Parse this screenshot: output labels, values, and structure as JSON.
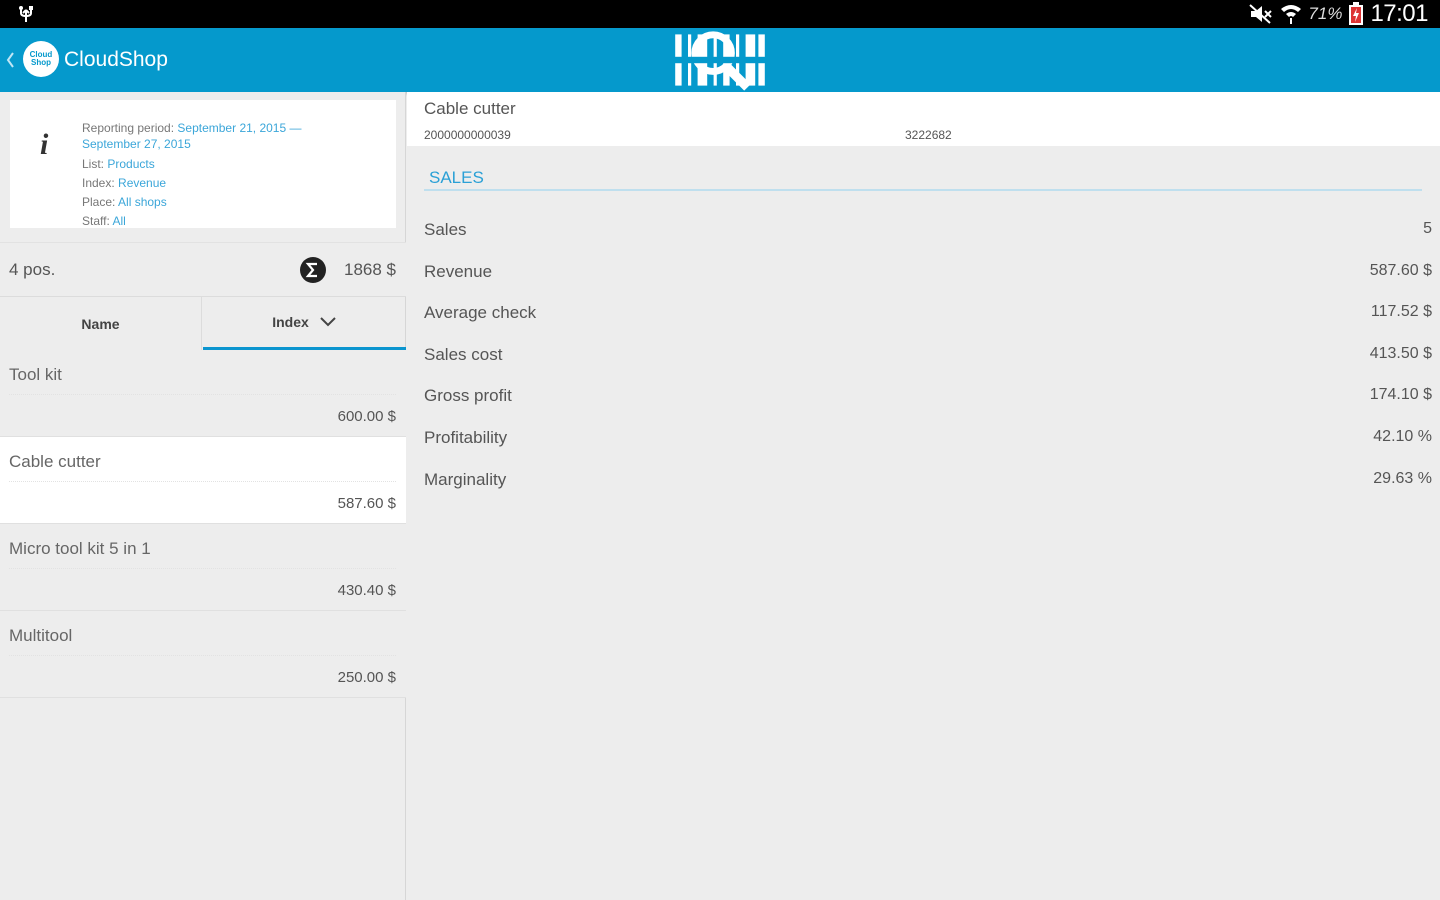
{
  "status_bar": {
    "battery_percent": "71%",
    "clock": "17:01"
  },
  "action_bar": {
    "logo_text": "Cloud Shop",
    "title": "CloudShop"
  },
  "info_card": {
    "reporting_period_label": "Reporting period:",
    "reporting_period_start": "September 21, 2015 —",
    "reporting_period_end": "September 27, 2015",
    "list_label": "List:",
    "list_value": "Products",
    "index_label": "Index:",
    "index_value": "Revenue",
    "place_label": "Place:",
    "place_value": "All shops",
    "staff_label": "Staff:",
    "staff_value": "All"
  },
  "summary": {
    "count": "4 pos.",
    "total": "1868 $"
  },
  "tabs": {
    "name_label": "Name",
    "index_label": "Index"
  },
  "items": [
    {
      "name": "Tool kit",
      "value": "600.00 $"
    },
    {
      "name": "Cable cutter",
      "value": "587.60 $"
    },
    {
      "name": "Micro tool kit 5 in 1",
      "value": "430.40 $"
    },
    {
      "name": "Multitool",
      "value": "250.00 $"
    }
  ],
  "selected_index": 1,
  "detail": {
    "name": "Cable cutter",
    "barcode": "2000000000039",
    "code": "3222682",
    "section_title": "SALES",
    "metrics": [
      {
        "label": "Sales",
        "value": "5"
      },
      {
        "label": "Revenue",
        "value": "587.60 $"
      },
      {
        "label": "Average check",
        "value": "117.52 $"
      },
      {
        "label": "Sales cost",
        "value": "413.50 $"
      },
      {
        "label": "Gross profit",
        "value": "174.10 $"
      },
      {
        "label": "Profitability",
        "value": "42.10 %"
      },
      {
        "label": "Marginality",
        "value": "29.63 %"
      }
    ]
  },
  "colors": {
    "action_bar": "#0599cc",
    "accent": "#0b95cf",
    "link": "#3ba6d9"
  }
}
